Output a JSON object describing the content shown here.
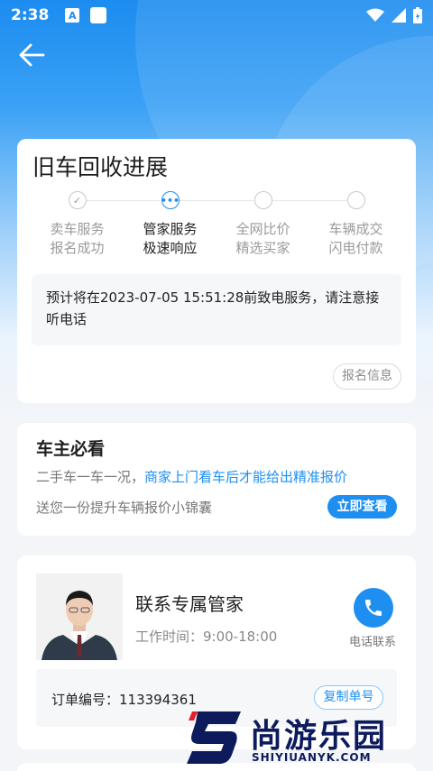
{
  "status_bar": {
    "time": "2:38",
    "badge_letter": "A"
  },
  "progress": {
    "title": "旧车回收进展",
    "steps": [
      {
        "line1": "卖车服务",
        "line2": "报名成功",
        "icon": "check-icon"
      },
      {
        "line1": "管家服务",
        "line2": "极速响应",
        "icon": "ellipsis-icon"
      },
      {
        "line1": "全网比价",
        "line2": "精选买家",
        "icon": ""
      },
      {
        "line1": "车辆成交",
        "line2": "闪电付款",
        "icon": ""
      }
    ],
    "current_step": 1,
    "check_glyph": "✓",
    "dots_glyph": "•••",
    "notice": "预计将在2023-07-05 15:51:28前致电服务，请注意接听电话",
    "registration_button": "报名信息"
  },
  "owner_tips": {
    "title": "车主必看",
    "line1_prefix": "二手车一车一况，",
    "line1_highlight": "商家上门看车后才能给出精准报价",
    "line2": "送您一份提升车辆报价小锦囊",
    "view_button": "立即查看"
  },
  "butler": {
    "name": "联系专属管家",
    "hours": "工作时间：9:00-18:00",
    "call_label": "电话联系",
    "order_label": "订单编号：113394361",
    "copy_button": "复制单号"
  },
  "watermark": {
    "title": "尚游乐园",
    "subtitle": "SHIYIUANYK.COM"
  },
  "colors": {
    "accent": "#1e8ff0",
    "header_gradient_top": "#1c8cf0",
    "page_bg": "#f3f5f9"
  }
}
